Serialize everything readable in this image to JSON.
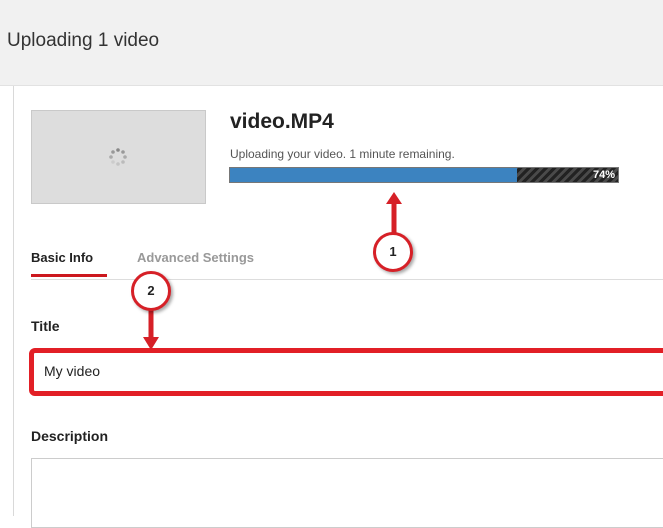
{
  "header": {
    "title": "Uploading 1 video"
  },
  "upload": {
    "filename": "video.MP4",
    "status": "Uploading your video. 1 minute remaining.",
    "progress_percent_label": "74%",
    "progress_fraction": 0.74
  },
  "tabs": [
    {
      "label": "Basic Info",
      "active": true
    },
    {
      "label": "Advanced Settings",
      "active": false
    }
  ],
  "form": {
    "title_label": "Title",
    "title_value": "My video",
    "description_label": "Description",
    "description_value": ""
  },
  "annotations": [
    {
      "number": "1"
    },
    {
      "number": "2"
    }
  ],
  "colors": {
    "progress_fill": "#3c83c0",
    "annotation_red": "#d62027",
    "tab_accent": "#cc181e"
  },
  "icons": {
    "thumbnail_spinner": "loading-spinner-icon",
    "arrow_up": "arrow-up-icon",
    "arrow_down": "arrow-down-icon"
  }
}
